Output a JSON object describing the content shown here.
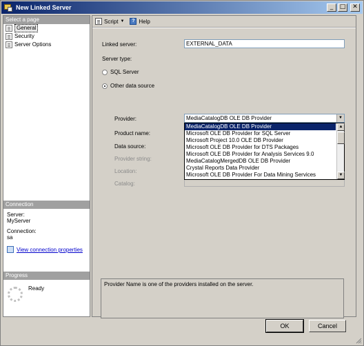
{
  "window": {
    "title": "New Linked Server"
  },
  "title_buttons": {
    "minimize": "_",
    "maximize": "□",
    "close": "✕"
  },
  "left_pane": {
    "select_page_header": "Select a page",
    "pages": [
      {
        "label": "General",
        "icon": "page-icon",
        "selected": true
      },
      {
        "label": "Security",
        "icon": "page-icon",
        "selected": false
      },
      {
        "label": "Server Options",
        "icon": "page-icon",
        "selected": false
      }
    ],
    "connection_header": "Connection",
    "server_label": "Server:",
    "server_value": "MyServer",
    "connection_label": "Connection:",
    "connection_value": "sa",
    "view_connection_properties": "View connection properties",
    "progress_header": "Progress",
    "progress_status": "Ready"
  },
  "toolbar": {
    "script_label": "Script",
    "script_caret": "▼",
    "help_label": "Help"
  },
  "form": {
    "linked_server_label": "Linked server:",
    "linked_server_value": "EXTERNAL_DATA",
    "server_type_label": "Server type:",
    "sql_server_label": "SQL Server",
    "other_data_source_label": "Other data source",
    "selected_server_type": "Other data source",
    "provider_label": "Provider:",
    "provider_value": "MediaCatalogDB OLE DB Provider",
    "combo_caret": "▼",
    "product_name_label": "Product name:",
    "data_source_label": "Data source:",
    "provider_string_label": "Provider string:",
    "location_label": "Location:",
    "catalog_label": "Catalog:"
  },
  "provider_dropdown": {
    "items": [
      "MediaCatalogDB OLE DB Provider",
      "Microsoft OLE DB Provider for SQL Server",
      "Microsoft Project 10.0 OLE DB Provider",
      "Microsoft OLE DB Provider for DTS Packages",
      "Microsoft OLE DB Provider for Analysis Services 9.0",
      "MediaCatalogMergedDB OLE DB Provider",
      "Crystal Reports Data Provider",
      "Microsoft OLE DB Provider For Data Mining Services"
    ],
    "selected_index": 0,
    "scroll_up": "▲",
    "scroll_down": "▼"
  },
  "description": "Provider Name is one of the providers installed on the server.",
  "buttons": {
    "ok": "OK",
    "cancel": "Cancel"
  }
}
